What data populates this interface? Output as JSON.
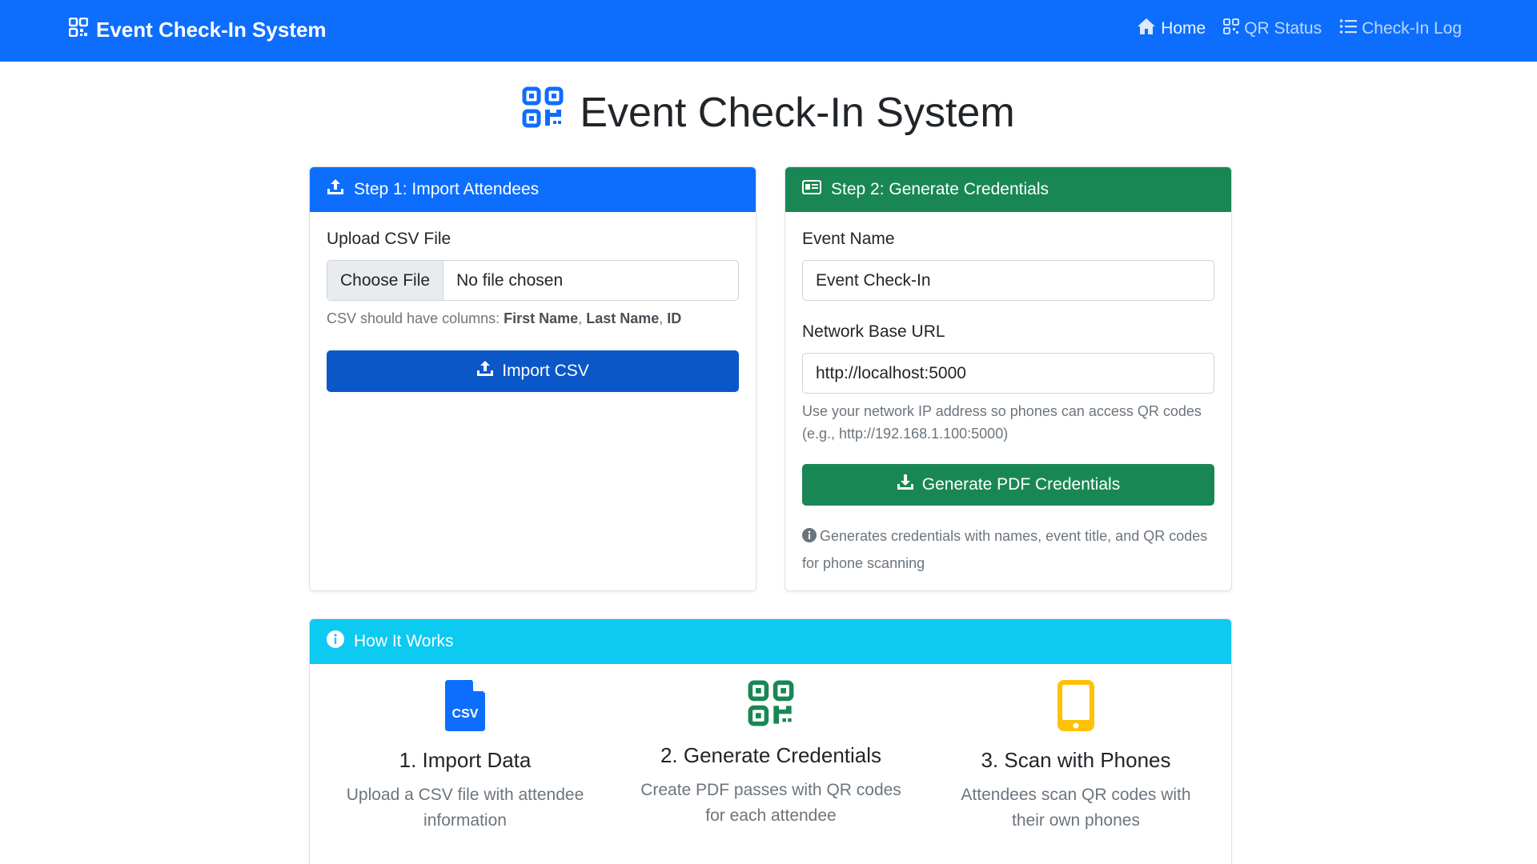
{
  "navbar": {
    "brand": "Event Check-In System",
    "links": [
      {
        "label": "Home",
        "icon": "house-icon"
      },
      {
        "label": "QR Status",
        "icon": "qr-icon"
      },
      {
        "label": "Check-In Log",
        "icon": "list-icon"
      }
    ]
  },
  "page": {
    "title": "Event Check-In System"
  },
  "colors": {
    "primary": "#0d6efd",
    "success": "#198754",
    "info": "#0dcaf0",
    "warning": "#ffc107"
  },
  "step1": {
    "header": "Step 1: Import Attendees",
    "upload_label": "Upload CSV File",
    "choose_file": "Choose File",
    "no_file": "No file chosen",
    "help_prefix": "CSV should have columns:",
    "col1": "First Name",
    "col2": "Last Name",
    "col3": "ID",
    "sep": ",",
    "button": "Import CSV"
  },
  "step2": {
    "header": "Step 2: Generate Credentials",
    "event_label": "Event Name",
    "event_value": "Event Check-In",
    "url_label": "Network Base URL",
    "url_value": "http://localhost:5000",
    "url_help": "Use your network IP address so phones can access QR codes (e.g., http://192.168.1.100:5000)",
    "button": "Generate PDF Credentials",
    "note": "Generates credentials with names, event title, and QR codes for phone scanning"
  },
  "how": {
    "header": "How It Works",
    "steps": [
      {
        "title": "1. Import Data",
        "desc": "Upload a CSV file with attendee information",
        "icon": "csv-file-icon"
      },
      {
        "title": "2. Generate Credentials",
        "desc": "Create PDF passes with QR codes for each attendee",
        "icon": "qr-code-icon"
      },
      {
        "title": "3. Scan with Phones",
        "desc": "Attendees scan QR codes with their own phones",
        "icon": "phone-icon"
      }
    ]
  }
}
